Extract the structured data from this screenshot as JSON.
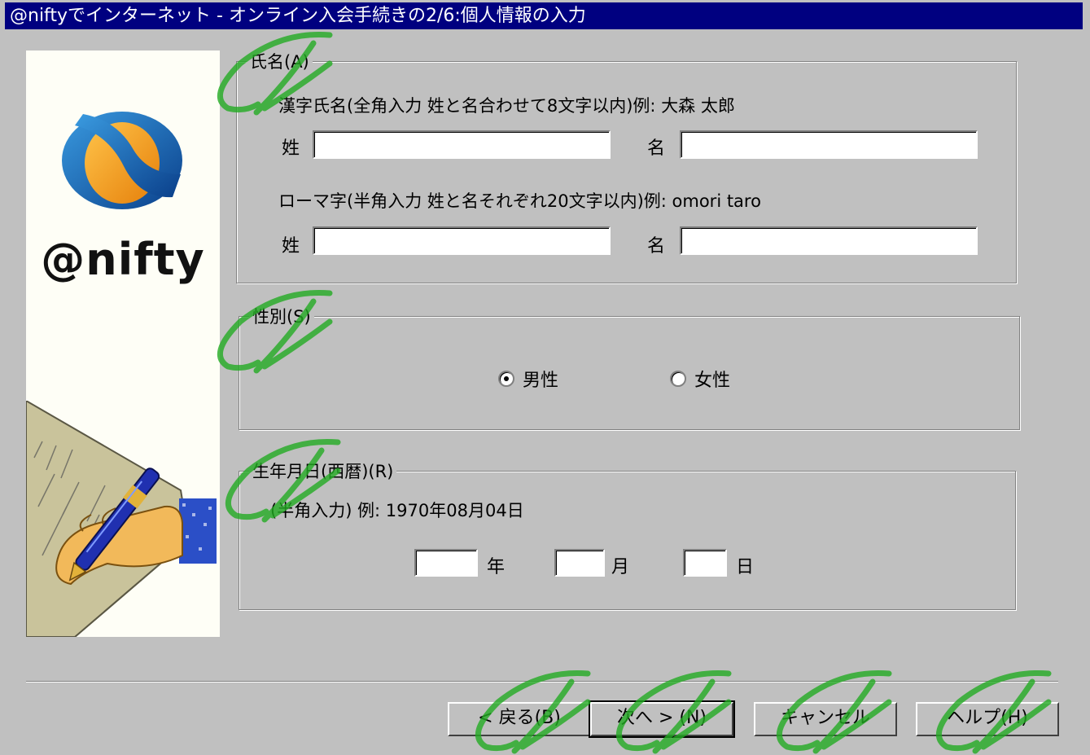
{
  "window": {
    "title": "@niftyでインターネット - オンライン入会手続きの2/6:個人情報の入力"
  },
  "sidebar": {
    "brand": "@nifty"
  },
  "name_group": {
    "legend": "氏名(A)",
    "kanji_hint": "漢字氏名(全角入力 姓と名合わせて8文字以内)例: 大森 太郎",
    "romaji_hint": "ローマ字(半角入力 姓と名それぞれ20文字以内)例: omori taro",
    "last_label": "姓",
    "first_label": "名",
    "kanji_last_value": "",
    "kanji_first_value": "",
    "romaji_last_value": "",
    "romaji_first_value": ""
  },
  "gender_group": {
    "legend": "性別(S)",
    "male_label": "男性",
    "female_label": "女性",
    "selected": "male"
  },
  "birth_group": {
    "legend": "生年月日(西暦)(R)",
    "hint": "(半角入力) 例: 1970年08月04日",
    "year_label": "年",
    "month_label": "月",
    "day_label": "日",
    "year_value": "",
    "month_value": "",
    "day_value": ""
  },
  "buttons": {
    "back": "< 戻る(B)",
    "next": "次へ > (N)",
    "cancel": "キャンセル",
    "help": "ヘルプ(H)"
  },
  "colors": {
    "titlebar": "#000080",
    "dialog_bg": "#c0c0c0",
    "annotation": "#22aa22"
  }
}
